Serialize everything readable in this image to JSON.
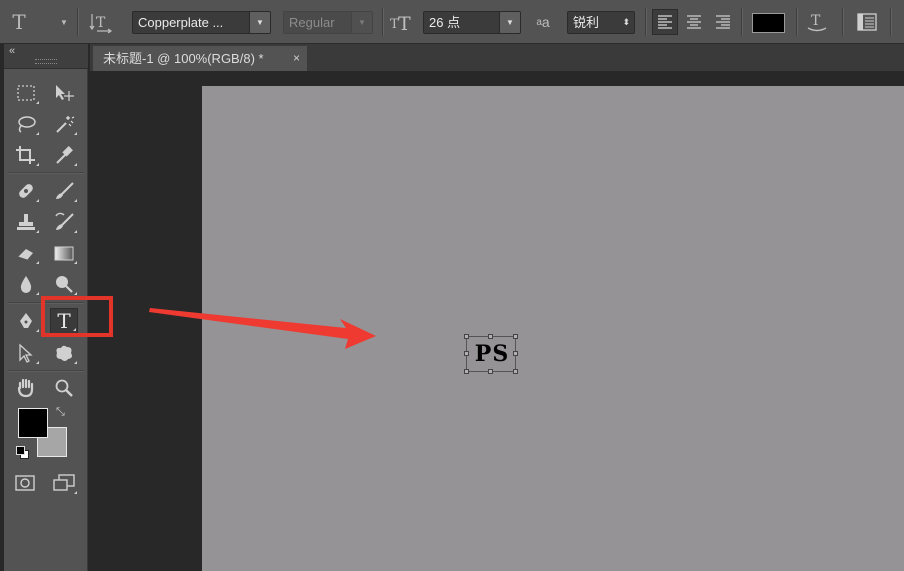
{
  "options_bar": {
    "font_family": "Copperplate ...",
    "font_style": "Regular",
    "font_size": "26 点",
    "antialias": "锐利",
    "text_color": "#000000",
    "icons": [
      "type-tool-preset-icon",
      "text-orientation-icon",
      "font-size-icon",
      "antialias-icon",
      "align-left-icon",
      "align-center-icon",
      "align-right-icon",
      "warp-text-icon",
      "character-panel-icon"
    ]
  },
  "toolbar": {
    "collapse_label": "«",
    "foreground_color": "#000000",
    "background_color": "#a6a6a6",
    "highlighted_tool": "type-tool"
  },
  "document": {
    "tab_title": "未标题-1 @ 100%(RGB/8) *",
    "tab_close": "×",
    "canvas_color": "#959395",
    "text_layer": "PS"
  },
  "annotation": {
    "color": "#e3342a"
  }
}
